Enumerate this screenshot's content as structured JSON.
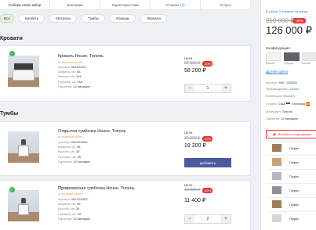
{
  "tabs": [
    {
      "label": "Собери свой набор",
      "active": true
    },
    {
      "label": "Описание"
    },
    {
      "label": "Характеристики"
    },
    {
      "label": "Отзывы",
      "count": "(1)"
    },
    {
      "label": "Услуги"
    }
  ],
  "chips": [
    "Все",
    "Кровати",
    "Матрасы",
    "Тумбы",
    "Комоды",
    "Зеркала"
  ],
  "sections": {
    "beds": "Кровати",
    "stands": "Тумбы"
  },
  "products": [
    {
      "name": "Кровать House, Тополь",
      "stock": "● Наличие много",
      "specs": [
        {
          "k": "Артикул:",
          "v": "КМ-022ХХ"
        },
        {
          "k": "Ширина, см:",
          "v": "63"
        },
        {
          "k": "Высота, см:",
          "v": "114"
        },
        {
          "k": "Глубина, см:",
          "v": "218"
        },
        {
          "k": "Гарантия:",
          "v": "12 месяцев"
        }
      ],
      "price_label": "Цена",
      "old_price": "97 000 ₽",
      "discount": "-40%",
      "new_price": "58 200 ₽",
      "qty": "1"
    },
    {
      "name": "Открытая тумбочка House, Тополь",
      "stock": "● Наличие много",
      "specs": [
        {
          "k": "Артикул:",
          "v": "КМ-022043"
        },
        {
          "k": "Ширина, см:",
          "v": "35"
        },
        {
          "k": "Высота, см:",
          "v": "30"
        },
        {
          "k": "Глубина, см:",
          "v": "35"
        },
        {
          "k": "Гарантия:",
          "v": "12 месяцев"
        }
      ],
      "price_label": "Цена",
      "old_price": "32 000 ₽",
      "discount": "-40%",
      "new_price": "19 200 ₽",
      "button": "Добавить"
    },
    {
      "name": "Прикроватная тумбочка House, Тополь",
      "stock": "● Наличие много",
      "specs": [
        {
          "k": "Артикул:",
          "v": "КМ-022433"
        },
        {
          "k": "Ширина, см:",
          "v": "39"
        },
        {
          "k": "Высота, см:",
          "v": "30"
        },
        {
          "k": "Глубина, см:",
          "v": "44"
        },
        {
          "k": "Гарантия:",
          "v": "12 месяцев"
        }
      ],
      "price_label": "Цена",
      "old_price": "19 000 ₽",
      "discount": "-40%",
      "new_price": "11 400 ₽",
      "qty": "2"
    }
  ],
  "panel": {
    "bought": "В набор: 5 товаров  на сумму",
    "old_total": "210 000 ₽",
    "discount": "-40%",
    "new_total": "126 000 ₽",
    "config_title": "Конфигурация",
    "swatches": [
      {
        "label": "Белый",
        "color": "#f4f4f4"
      },
      {
        "label": "Графит",
        "color": "#5d6166"
      },
      {
        "label": "Белый",
        "color": "#e8e8e8"
      }
    ],
    "other_colors": "Другие цвета",
    "attrs": [
      {
        "k": "Артикул:",
        "v": "КМ - 024035"
      },
      {
        "k": "Производитель:",
        "v": "House",
        "link": true
      },
      {
        "k": "Коллекция:",
        "v": "Wooden",
        "link": true
      },
      {
        "k": "Страна:",
        "v": "США",
        "v2": "Испания",
        "flags": true
      },
      {
        "k": "Материал:",
        "v": "Тополь"
      },
      {
        "k": "Гарантия:",
        "v": "12 месяцев"
      }
    ],
    "choose": "Выберите подходящие",
    "items": [
      "Пуфик",
      "Пуфик",
      "Пуфик",
      "Пуфик",
      "Пуфик",
      "Пуфик"
    ]
  }
}
